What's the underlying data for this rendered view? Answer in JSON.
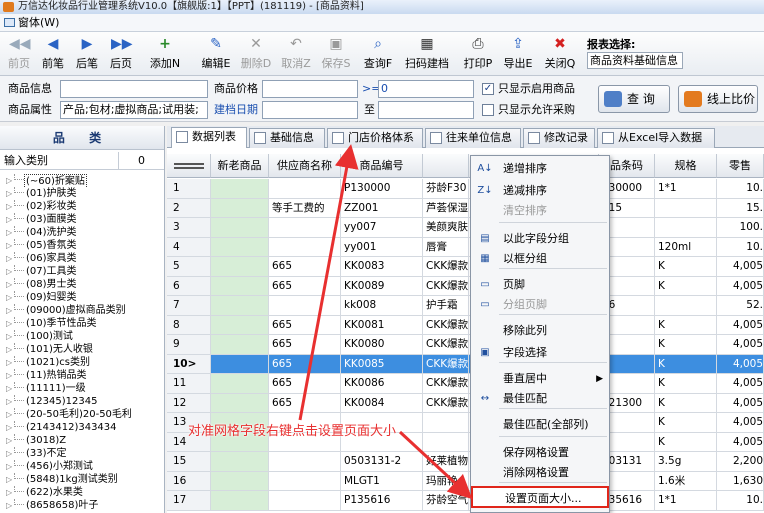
{
  "window": {
    "title": "万信达化妆品行业管理系统V10.0【旗舰版:1】【PPT】(181119) - [商品资料]"
  },
  "menubar": {
    "label": "窗体(W)"
  },
  "toolbar": {
    "buttons": [
      {
        "label": "前页",
        "icon": "◀◀",
        "enabled": false
      },
      {
        "label": "前笔",
        "icon": "◀",
        "enabled": true
      },
      {
        "label": "后笔",
        "icon": "▶",
        "enabled": true
      },
      {
        "label": "后页",
        "icon": "▶▶",
        "enabled": true
      },
      {
        "label": "添加N",
        "icon": "+",
        "enabled": true
      },
      {
        "label": "编辑E",
        "icon": "✎",
        "enabled": true
      },
      {
        "label": "删除D",
        "icon": "✕",
        "enabled": false
      },
      {
        "label": "取消Z",
        "icon": "↶",
        "enabled": false
      },
      {
        "label": "保存S",
        "icon": "▣",
        "enabled": false
      },
      {
        "label": "查询F",
        "icon": "⌕",
        "enabled": true
      },
      {
        "label": "扫码建档",
        "icon": "▦",
        "enabled": true
      },
      {
        "label": "打印P",
        "icon": "⎙",
        "enabled": true
      },
      {
        "label": "导出E",
        "icon": "⇪",
        "enabled": true
      },
      {
        "label": "关闭Q",
        "icon": "✖",
        "enabled": true
      }
    ],
    "report_select_label": "报表选择:",
    "report_select_value": "商品资料基础信息"
  },
  "filter": {
    "product_info_label": "商品信息",
    "product_info_value": "",
    "price_label": "商品价格",
    "price_op": ">=",
    "price_value": "0",
    "show_enabled_label": "只显示启用商品",
    "show_enabled_checked": true,
    "attr_label": "商品属性",
    "attr_value": "产品;包材;虚拟商品;试用装;",
    "date_label": "建档日期",
    "to_label": "至",
    "show_purchase_label": "只显示允许采购",
    "show_purchase_checked": false,
    "query_button": "查 询",
    "compare_button": "线上比价"
  },
  "category_panel": {
    "title": "品 类",
    "input_label": "输入类别",
    "input_count": "0",
    "items": [
      {
        "label": "(~60)折案贴",
        "selected": true
      },
      {
        "label": "(01)护肤类"
      },
      {
        "label": "(02)彩妆类"
      },
      {
        "label": "(03)面膜类"
      },
      {
        "label": "(04)洗护类"
      },
      {
        "label": "(05)香氛类"
      },
      {
        "label": "(06)家具类"
      },
      {
        "label": "(07)工具类"
      },
      {
        "label": "(08)男士类"
      },
      {
        "label": "(09)妇婴类"
      },
      {
        "label": "(09000)虚拟商品类别"
      },
      {
        "label": "(10)季节性品类"
      },
      {
        "label": "(100)测试"
      },
      {
        "label": "(101)无人收银"
      },
      {
        "label": "(1021)cs类别"
      },
      {
        "label": "(11)热销品类"
      },
      {
        "label": "(11111)一级"
      },
      {
        "label": "(12345)12345"
      },
      {
        "label": "(20-50毛利)20-50毛利"
      },
      {
        "label": "(2143412)343434"
      },
      {
        "label": "(3018)Z"
      },
      {
        "label": "(33)不定"
      },
      {
        "label": "(456)小郑测试"
      },
      {
        "label": "(5848)1kg测试类别"
      },
      {
        "label": "(622)水果类"
      },
      {
        "label": "(8658658)叶子"
      }
    ]
  },
  "tabs": [
    {
      "label": "数据列表",
      "active": true
    },
    {
      "label": "基础信息"
    },
    {
      "label": "门店价格体系"
    },
    {
      "label": "往来单位信息"
    },
    {
      "label": "修改记录"
    },
    {
      "label": "从Excel导入数据"
    }
  ],
  "grid": {
    "columns": [
      "",
      "新老商品",
      "供应商名称",
      "商品编号",
      "",
      "",
      "",
      "品条码",
      "规格",
      "零售"
    ],
    "rows": [
      [
        "1",
        "",
        "",
        "P130000",
        "芬龄F30",
        "130000",
        "1*1",
        "10."
      ],
      [
        "2",
        "",
        "等手工费的",
        "ZZ001",
        "芦荟保湿",
        "415",
        "",
        "15."
      ],
      [
        "3",
        "",
        "",
        "yy007",
        "美颜爽肤",
        "6",
        "",
        "100."
      ],
      [
        "4",
        "",
        "",
        "yy001",
        "唇膏",
        "",
        "120ml",
        "10."
      ],
      [
        "5",
        "",
        "665",
        "KK0083",
        "CKK爆款",
        "",
        "K",
        "4,005"
      ],
      [
        "6",
        "",
        "665",
        "KK0089",
        "CKK爆款",
        "",
        "K",
        "4,005"
      ],
      [
        "7",
        "",
        "",
        "kk008",
        "护手霜",
        "56",
        "",
        "52."
      ],
      [
        "8",
        "",
        "665",
        "KK0081",
        "CKK爆款",
        "",
        "K",
        "4,005"
      ],
      [
        "9",
        "",
        "665",
        "KK0080",
        "CKK爆款",
        "",
        "K",
        "4,005"
      ],
      [
        "10>",
        "",
        "665",
        "KK0085",
        "CKK爆款",
        "",
        "K",
        "4,005"
      ],
      [
        "11",
        "",
        "665",
        "KK0086",
        "CKK爆款",
        "",
        "K",
        "4,005"
      ],
      [
        "12",
        "",
        "665",
        "KK0084",
        "CKK爆款",
        "021300",
        "K",
        "4,005"
      ],
      [
        "13",
        "",
        "",
        "",
        "",
        "",
        "K",
        "4,005"
      ],
      [
        "14",
        "",
        "",
        "",
        "",
        "",
        "K",
        "4,005"
      ],
      [
        "15",
        "",
        "",
        "0503131-2",
        "好莱植物",
        "503131",
        "3.5g",
        "2,200"
      ],
      [
        "16",
        "",
        "",
        "MLGT1",
        "玛丽艳",
        "",
        "1.6米",
        "1,630"
      ],
      [
        "17",
        "",
        "",
        "P135616",
        "芬龄空气",
        "135616",
        "1*1",
        "10."
      ]
    ],
    "selected_row": 9
  },
  "context_menu": {
    "items": [
      {
        "label": "递增排序",
        "icon": "A↓"
      },
      {
        "label": "递减排序",
        "icon": "Z↓"
      },
      {
        "label": "清空排序",
        "enabled": false
      },
      {
        "label": "以此字段分组",
        "icon": "▤"
      },
      {
        "label": "以框分组",
        "icon": "▦"
      },
      {
        "label": "页脚",
        "icon": "▭"
      },
      {
        "label": "分组页脚",
        "icon": "▭",
        "enabled": false
      },
      {
        "label": "移除此列"
      },
      {
        "label": "字段选择",
        "icon": "▣"
      },
      {
        "label": "垂直居中",
        "submenu": true
      },
      {
        "label": "最佳匹配",
        "icon": "↔"
      },
      {
        "label": "最佳匹配(全部列)"
      },
      {
        "label": "保存网格设置"
      },
      {
        "label": "消除网格设置"
      },
      {
        "label": "设置页面大小...",
        "highlighted": true
      }
    ]
  },
  "annotation": {
    "text": "对准网格字段右键点击设置页面大小",
    "color": "#e83030"
  }
}
